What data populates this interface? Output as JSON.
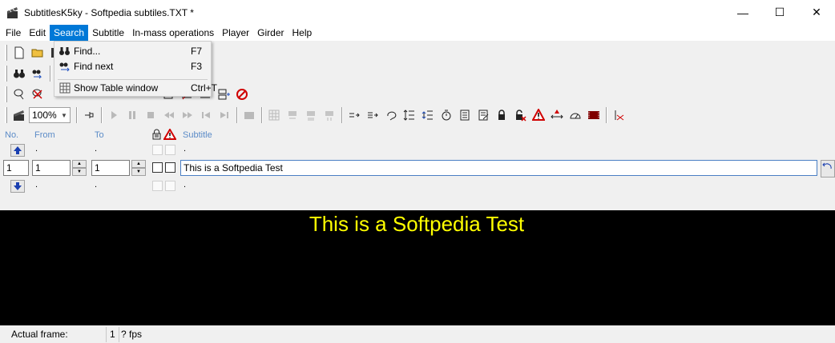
{
  "window": {
    "title": "SubtitlesK5ky - Softpedia subtiles.TXT *",
    "controls": {
      "minimize": "—",
      "maximize": "☐",
      "close": "✕"
    }
  },
  "menubar": {
    "items": [
      {
        "label": "File"
      },
      {
        "label": "Edit"
      },
      {
        "label": "Search"
      },
      {
        "label": "Subtitle"
      },
      {
        "label": "In-mass operations"
      },
      {
        "label": "Player"
      },
      {
        "label": "Girder"
      },
      {
        "label": "Help"
      }
    ],
    "active": "Search"
  },
  "search_menu": {
    "items": [
      {
        "label": "Find...",
        "shortcut": "F7",
        "icon": "binoculars-icon"
      },
      {
        "label": "Find next",
        "shortcut": "F3",
        "icon": "find-next-icon"
      },
      {
        "label": "Show Table window",
        "shortcut": "Ctrl+T",
        "icon": "table-icon"
      }
    ]
  },
  "toolbar": {
    "zoom": "100%"
  },
  "editor": {
    "headers": {
      "no": "No.",
      "from": "From",
      "to": "To",
      "subtitle": "Subtitle"
    },
    "placeholder_dot": ".",
    "current": {
      "number": "1",
      "from": "1",
      "to": "1",
      "text": "This is a Softpedia Test"
    }
  },
  "preview": {
    "caption": "This is a Softpedia Test",
    "caption_color": "#ffff00",
    "background": "#000000"
  },
  "statusbar": {
    "frame_label": "Actual frame:",
    "frame_value": "1",
    "fps": "? fps"
  }
}
